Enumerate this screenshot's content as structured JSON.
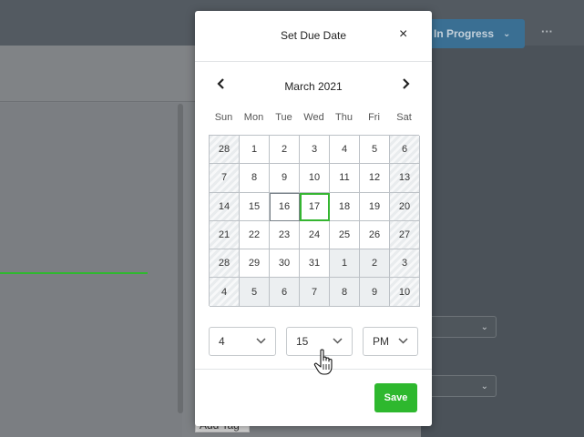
{
  "background": {
    "status_label": "In Progress",
    "more_label": "···",
    "add_tag_label": "Add Tag"
  },
  "modal": {
    "title": "Set Due Date",
    "close_glyph": "×",
    "month_label": "March 2021",
    "prev_glyph": "‹",
    "next_glyph": "›",
    "weekdays": [
      "Sun",
      "Mon",
      "Tue",
      "Wed",
      "Thu",
      "Fri",
      "Sat"
    ],
    "weeks": [
      [
        "28",
        "1",
        "2",
        "3",
        "4",
        "5",
        "6"
      ],
      [
        "7",
        "8",
        "9",
        "10",
        "11",
        "12",
        "13"
      ],
      [
        "14",
        "15",
        "16",
        "17",
        "18",
        "19",
        "20"
      ],
      [
        "21",
        "22",
        "23",
        "24",
        "25",
        "26",
        "27"
      ],
      [
        "28",
        "29",
        "30",
        "31",
        "1",
        "2",
        "3"
      ],
      [
        "4",
        "5",
        "6",
        "7",
        "8",
        "9",
        "10"
      ]
    ],
    "today": "16",
    "selected": "17",
    "hour_value": "4",
    "minute_value": "15",
    "ampm_value": "PM",
    "save_label": "Save"
  },
  "colors": {
    "accent_green": "#2eb82e",
    "status_blue": "#3a6f93"
  }
}
